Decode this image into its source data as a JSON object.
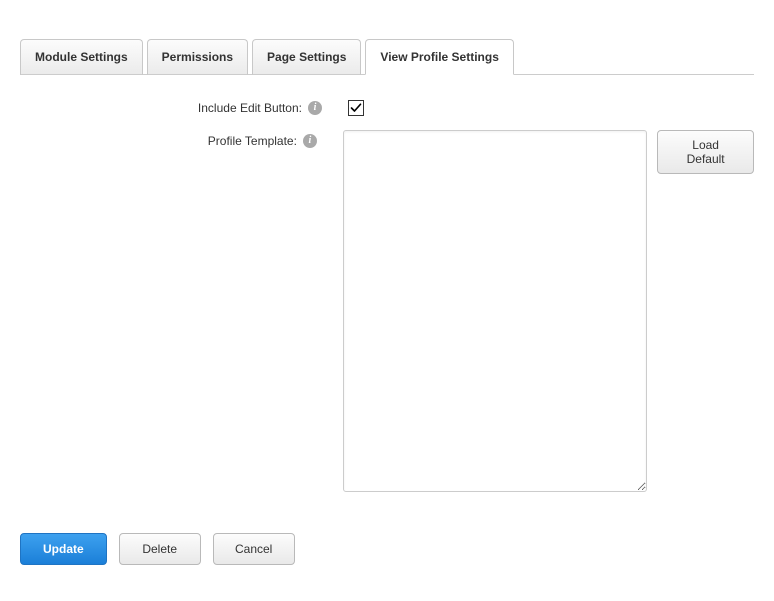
{
  "tabs": {
    "module_settings": "Module Settings",
    "permissions": "Permissions",
    "page_settings": "Page Settings",
    "view_profile_settings": "View Profile Settings"
  },
  "form": {
    "include_edit_button_label": "Include Edit Button:",
    "include_edit_button_checked": true,
    "profile_template_label": "Profile Template:",
    "profile_template_value": "",
    "load_default_label": "Load Default"
  },
  "actions": {
    "update": "Update",
    "delete": "Delete",
    "cancel": "Cancel"
  }
}
